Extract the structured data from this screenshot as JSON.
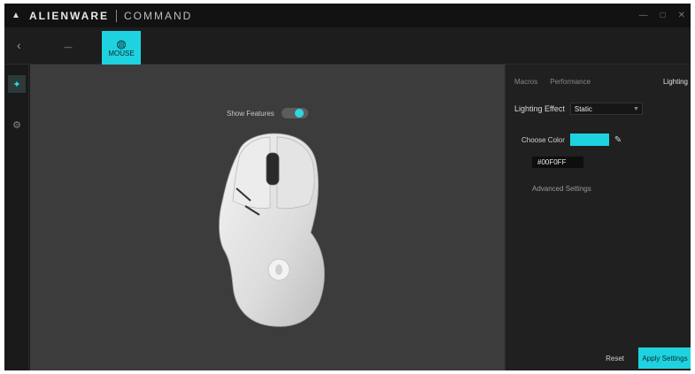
{
  "titlebar": {
    "logo_icon": "alien-logo-icon",
    "app_name": "ALIENWARE",
    "section": "COMMAND",
    "controls": [
      "—",
      "□",
      "✕"
    ]
  },
  "tabs": {
    "back_icon": "back-arrow-icon",
    "items": [
      {
        "label": "—",
        "active": false
      },
      {
        "label": "MOUSE",
        "active": true
      }
    ]
  },
  "rail": {
    "buttons": [
      {
        "icon": "lighting-icon",
        "active": true
      },
      {
        "icon": "settings-icon",
        "active": false
      }
    ]
  },
  "canvas": {
    "view_label": "Show Features",
    "toggle_on": true
  },
  "panel": {
    "header_items": [
      "Macros",
      "Performance",
      "Lighting"
    ],
    "lighting_label": "Lighting Effect",
    "mode_value": "Static",
    "color_label": "Choose Color",
    "hex_value": "#00F0FF",
    "advanced_label": "Advanced Settings",
    "reset_label": "Reset",
    "apply_label": "Apply Settings"
  },
  "colors": {
    "accent": "#1fd2e0",
    "background": "#1b1b1b",
    "canvas": "#3c3c3c",
    "mouse_body": "#e6e6e6"
  }
}
